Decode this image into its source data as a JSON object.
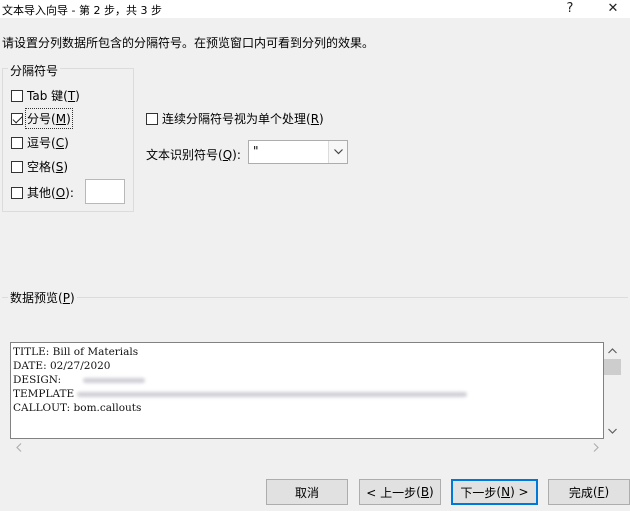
{
  "window": {
    "title": "文本导入向导 - 第 2 步，共 3 步",
    "help_label": "?",
    "close_label": "✕"
  },
  "instruction": "请设置分列数据所包含的分隔符号。在预览窗口内可看到分列的效果。",
  "delimiters": {
    "legend": "分隔符号",
    "items": [
      {
        "label": "Tab 键",
        "key": "T",
        "checked": false
      },
      {
        "label": "分号",
        "key": "M",
        "checked": true
      },
      {
        "label": "逗号",
        "key": "C",
        "checked": false
      },
      {
        "label": "空格",
        "key": "S",
        "checked": false
      },
      {
        "label": "其他",
        "key": "O",
        "checked": false
      }
    ],
    "other_value": ""
  },
  "consecutive": {
    "label": "连续分隔符号视为单个处理",
    "key": "R",
    "checked": false
  },
  "qualifier": {
    "label": "文本识别符号",
    "key": "Q",
    "value": "\""
  },
  "preview": {
    "legend": "数据预览",
    "legend_key": "P",
    "lines": [
      {
        "text": "TITLE: Bill of Materials"
      },
      {
        "text": "DATE: 02/27/2020"
      },
      {
        "text": "DESIGN:"
      },
      {
        "text": "TEMPLATE"
      },
      {
        "text": "CALLOUT: bom.callouts"
      }
    ]
  },
  "buttons": {
    "cancel": "取消",
    "back": "< 上一步",
    "back_key": "B",
    "next": "下一步",
    "next_key": "N",
    "finish": "完成",
    "finish_key": "F"
  },
  "colors": {
    "default_button_border": "#0078d7",
    "dialog_bg": "#f0f0f0"
  }
}
